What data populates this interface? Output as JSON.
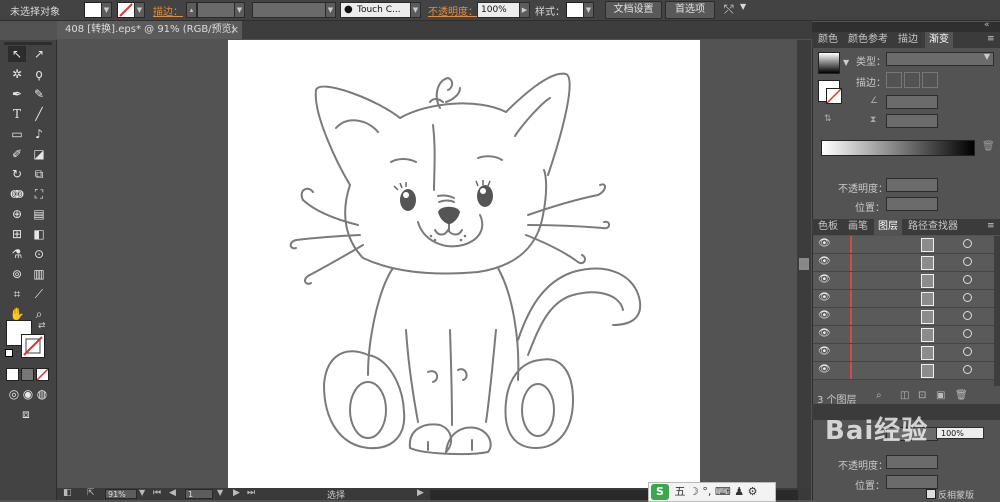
{
  "control_bar": {
    "selection_status": "未选择对象",
    "stroke_label": "描边：",
    "brush_name": "Touch C...",
    "opacity_label": "不透明度：",
    "opacity_value": "100%",
    "style_label": "样式：",
    "doc_setup_button": "文档设置",
    "preferences_button": "首选项"
  },
  "document": {
    "tab_title": "408 [转换].eps* @ 91% (RGB/预览)",
    "close_glyph": "×"
  },
  "status_bar": {
    "zoom": "91%",
    "page": "1",
    "tool_status": "选择"
  },
  "panels": {
    "top_tabs": [
      "颜色",
      "颜色参考",
      "描边",
      "渐变"
    ],
    "gradient": {
      "type_label": "类型：",
      "stroke_label": "描边：",
      "opacity_label": "不透明度：",
      "position_label": "位置："
    },
    "layers_tabs": [
      "色板",
      "画笔",
      "图层",
      "路径查找器"
    ],
    "layers_count": "3 个图层",
    "bottom": {
      "opacity_label": "不透明度：",
      "opacity_value": "100%",
      "position_label": "位置：",
      "invert_mask_label": "反相蒙版"
    }
  },
  "watermark": {
    "text": "Bai经验"
  },
  "ime": {
    "text": "五 ☽ °, ⌨ ♟ ⚙"
  },
  "colors": {
    "ui_dark": "#434343",
    "ui_mid": "#535353",
    "accent_orange": "#e58b3a",
    "layer_red": "#d24b4b"
  }
}
